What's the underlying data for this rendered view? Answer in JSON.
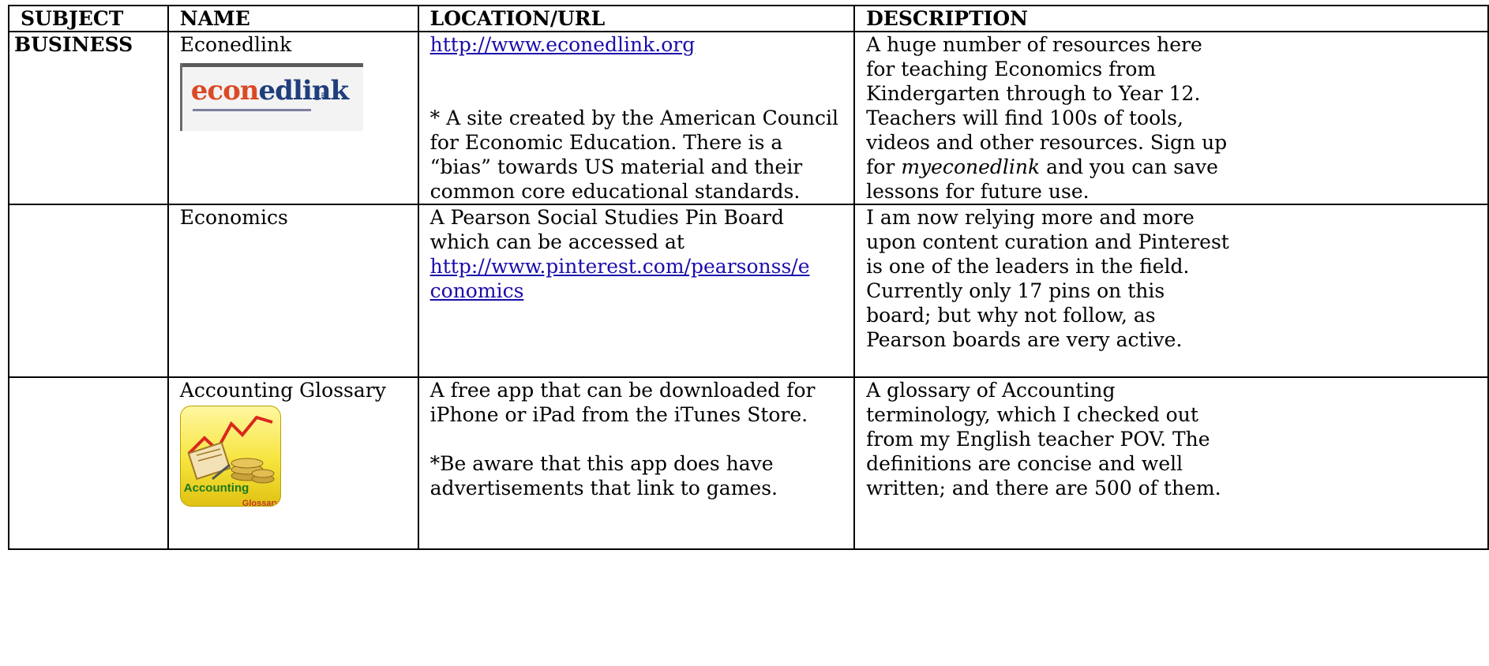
{
  "headers": [
    "SUBJECT",
    "NAME",
    "LOCATION/URL",
    "DESCRIPTION"
  ],
  "rows": [
    {
      "subject": "BUSINESS",
      "name": "Econedlink",
      "logo": {
        "icon": "econedlink-logo",
        "word_a": "econ",
        "word_b": "edlink"
      },
      "location": {
        "link": "http://www.econedlink.org",
        "note": [
          "* A site created by the American Council",
          "for Economic Education. There is a",
          "“bias” towards US material and their",
          "common core educational standards."
        ]
      },
      "description": {
        "lines": [
          "A huge number of resources here",
          "for teaching Economics from",
          "Kindergarten through to Year 12.",
          "Teachers will find 100s of tools,",
          "videos and other resources. Sign up"
        ],
        "last_pre": "for ",
        "last_em": "myeconedlink",
        "last_post": " and you can save",
        "final": "lessons for future use."
      }
    },
    {
      "subject": "",
      "name": "Economics",
      "location": {
        "lines": [
          "A Pearson Social Studies Pin Board",
          "which can be accessed at"
        ],
        "link_lines": [
          "http://www.pinterest.com/pearsonss/e",
          "conomics"
        ]
      },
      "description": {
        "lines": [
          "I am now relying more and more",
          "upon content curation and Pinterest",
          "is one of the leaders in the field.",
          "Currently only 17 pins on this",
          "board; but why not follow, as",
          "Pearson boards are very active."
        ]
      }
    },
    {
      "subject": "",
      "name": "Accounting Glossary",
      "icon": {
        "name": "accounting-glossary-app-icon",
        "word_a": "Accounting",
        "word_b": "Glossary"
      },
      "location": {
        "lines": [
          "A free app that can be downloaded for",
          "iPhone or iPad from the iTunes Store."
        ],
        "note": [
          "*Be aware that this app does have",
          "advertisements that link to games."
        ]
      },
      "description": {
        "lines": [
          "A glossary of Accounting",
          "terminology, which I checked out",
          "from my English teacher POV. The",
          "definitions are concise and well",
          "written; and there are 500 of them."
        ]
      }
    }
  ],
  "colors": {
    "link": "#1a0dab",
    "logo_red": "#d94a26",
    "logo_blue": "#1f3e7c",
    "icon_yellow": "#f6e43c"
  }
}
